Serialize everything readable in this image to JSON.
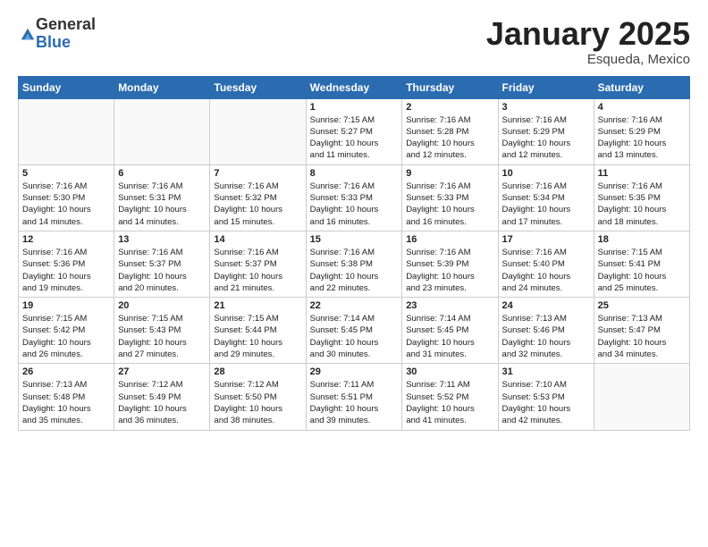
{
  "logo": {
    "general": "General",
    "blue": "Blue"
  },
  "title": "January 2025",
  "subtitle": "Esqueda, Mexico",
  "days": [
    "Sunday",
    "Monday",
    "Tuesday",
    "Wednesday",
    "Thursday",
    "Friday",
    "Saturday"
  ],
  "weeks": [
    [
      {
        "day": "",
        "content": ""
      },
      {
        "day": "",
        "content": ""
      },
      {
        "day": "",
        "content": ""
      },
      {
        "day": "1",
        "content": "Sunrise: 7:15 AM\nSunset: 5:27 PM\nDaylight: 10 hours\nand 11 minutes."
      },
      {
        "day": "2",
        "content": "Sunrise: 7:16 AM\nSunset: 5:28 PM\nDaylight: 10 hours\nand 12 minutes."
      },
      {
        "day": "3",
        "content": "Sunrise: 7:16 AM\nSunset: 5:29 PM\nDaylight: 10 hours\nand 12 minutes."
      },
      {
        "day": "4",
        "content": "Sunrise: 7:16 AM\nSunset: 5:29 PM\nDaylight: 10 hours\nand 13 minutes."
      }
    ],
    [
      {
        "day": "5",
        "content": "Sunrise: 7:16 AM\nSunset: 5:30 PM\nDaylight: 10 hours\nand 14 minutes."
      },
      {
        "day": "6",
        "content": "Sunrise: 7:16 AM\nSunset: 5:31 PM\nDaylight: 10 hours\nand 14 minutes."
      },
      {
        "day": "7",
        "content": "Sunrise: 7:16 AM\nSunset: 5:32 PM\nDaylight: 10 hours\nand 15 minutes."
      },
      {
        "day": "8",
        "content": "Sunrise: 7:16 AM\nSunset: 5:33 PM\nDaylight: 10 hours\nand 16 minutes."
      },
      {
        "day": "9",
        "content": "Sunrise: 7:16 AM\nSunset: 5:33 PM\nDaylight: 10 hours\nand 16 minutes."
      },
      {
        "day": "10",
        "content": "Sunrise: 7:16 AM\nSunset: 5:34 PM\nDaylight: 10 hours\nand 17 minutes."
      },
      {
        "day": "11",
        "content": "Sunrise: 7:16 AM\nSunset: 5:35 PM\nDaylight: 10 hours\nand 18 minutes."
      }
    ],
    [
      {
        "day": "12",
        "content": "Sunrise: 7:16 AM\nSunset: 5:36 PM\nDaylight: 10 hours\nand 19 minutes."
      },
      {
        "day": "13",
        "content": "Sunrise: 7:16 AM\nSunset: 5:37 PM\nDaylight: 10 hours\nand 20 minutes."
      },
      {
        "day": "14",
        "content": "Sunrise: 7:16 AM\nSunset: 5:37 PM\nDaylight: 10 hours\nand 21 minutes."
      },
      {
        "day": "15",
        "content": "Sunrise: 7:16 AM\nSunset: 5:38 PM\nDaylight: 10 hours\nand 22 minutes."
      },
      {
        "day": "16",
        "content": "Sunrise: 7:16 AM\nSunset: 5:39 PM\nDaylight: 10 hours\nand 23 minutes."
      },
      {
        "day": "17",
        "content": "Sunrise: 7:16 AM\nSunset: 5:40 PM\nDaylight: 10 hours\nand 24 minutes."
      },
      {
        "day": "18",
        "content": "Sunrise: 7:15 AM\nSunset: 5:41 PM\nDaylight: 10 hours\nand 25 minutes."
      }
    ],
    [
      {
        "day": "19",
        "content": "Sunrise: 7:15 AM\nSunset: 5:42 PM\nDaylight: 10 hours\nand 26 minutes."
      },
      {
        "day": "20",
        "content": "Sunrise: 7:15 AM\nSunset: 5:43 PM\nDaylight: 10 hours\nand 27 minutes."
      },
      {
        "day": "21",
        "content": "Sunrise: 7:15 AM\nSunset: 5:44 PM\nDaylight: 10 hours\nand 29 minutes."
      },
      {
        "day": "22",
        "content": "Sunrise: 7:14 AM\nSunset: 5:45 PM\nDaylight: 10 hours\nand 30 minutes."
      },
      {
        "day": "23",
        "content": "Sunrise: 7:14 AM\nSunset: 5:45 PM\nDaylight: 10 hours\nand 31 minutes."
      },
      {
        "day": "24",
        "content": "Sunrise: 7:13 AM\nSunset: 5:46 PM\nDaylight: 10 hours\nand 32 minutes."
      },
      {
        "day": "25",
        "content": "Sunrise: 7:13 AM\nSunset: 5:47 PM\nDaylight: 10 hours\nand 34 minutes."
      }
    ],
    [
      {
        "day": "26",
        "content": "Sunrise: 7:13 AM\nSunset: 5:48 PM\nDaylight: 10 hours\nand 35 minutes."
      },
      {
        "day": "27",
        "content": "Sunrise: 7:12 AM\nSunset: 5:49 PM\nDaylight: 10 hours\nand 36 minutes."
      },
      {
        "day": "28",
        "content": "Sunrise: 7:12 AM\nSunset: 5:50 PM\nDaylight: 10 hours\nand 38 minutes."
      },
      {
        "day": "29",
        "content": "Sunrise: 7:11 AM\nSunset: 5:51 PM\nDaylight: 10 hours\nand 39 minutes."
      },
      {
        "day": "30",
        "content": "Sunrise: 7:11 AM\nSunset: 5:52 PM\nDaylight: 10 hours\nand 41 minutes."
      },
      {
        "day": "31",
        "content": "Sunrise: 7:10 AM\nSunset: 5:53 PM\nDaylight: 10 hours\nand 42 minutes."
      },
      {
        "day": "",
        "content": ""
      }
    ]
  ]
}
